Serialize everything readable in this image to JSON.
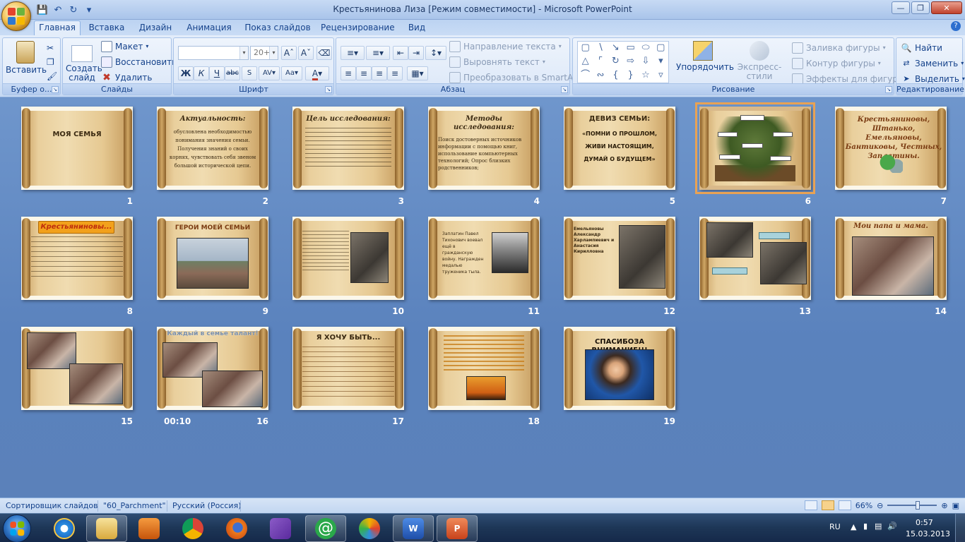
{
  "window": {
    "title": "Крестьянинова Лиза [Режим совместимости] - Microsoft PowerPoint"
  },
  "tabs": [
    "Главная",
    "Вставка",
    "Дизайн",
    "Анимация",
    "Показ слайдов",
    "Рецензирование",
    "Вид"
  ],
  "ribbon": {
    "clipboard": {
      "title": "Буфер о...",
      "paste": "Вставить"
    },
    "slides": {
      "title": "Слайды",
      "create": "Создать слайд",
      "layout": "Макет",
      "reset": "Восстановить",
      "delete": "Удалить"
    },
    "font": {
      "title": "Шрифт",
      "size": "20+"
    },
    "paragraph": {
      "title": "Абзац",
      "text_direction": "Направление текста",
      "align_text": "Выровнять текст",
      "smartart": "Преобразовать в SmartArt"
    },
    "drawing": {
      "title": "Рисование",
      "arrange": "Упорядочить",
      "quick_styles": "Экспресс-стили",
      "fill": "Заливка фигуры",
      "outline": "Контур фигуры",
      "effects": "Эффекты для фигур"
    },
    "editing": {
      "title": "Редактирование",
      "find": "Найти",
      "replace": "Заменить",
      "select": "Выделить"
    }
  },
  "slides": [
    {
      "num": "1",
      "title": "МОЯ СЕМЬЯ"
    },
    {
      "num": "2",
      "title": "Актуальность:",
      "body": "обусловлена необходимостью понимания значения семьи. Получения знаний о своих корнях, чувствовать себя звеном большой исторической цепи."
    },
    {
      "num": "3",
      "title": "Цель исследования:"
    },
    {
      "num": "4",
      "title": "Методы исследования:",
      "body": "Поиск достоверных источников информации с помощью книг, использование компьютерных технологий; Опрос близких родственников;"
    },
    {
      "num": "5",
      "title": "ДЕВИЗ СЕМЬИ:",
      "body": "«ПОМНИ О ПРОШЛОМ, ЖИВИ НАСТОЯЩИМ, ДУМАЙ О БУДУЩЕМ»"
    },
    {
      "num": "6"
    },
    {
      "num": "7",
      "title": "Крестьяниновы, Штанько, Емельяновы, Бантиковы, Честных, Заплатины."
    },
    {
      "num": "8",
      "title": "Крестьяниновы..."
    },
    {
      "num": "9",
      "title": "ГЕРОИ МОЕЙ СЕМЬИ"
    },
    {
      "num": "10"
    },
    {
      "num": "11",
      "body": "Заплатин Павел Тихонович воевал ещё в гражданскую войну. Награжден медалью труженика тыла."
    },
    {
      "num": "12",
      "body": "Емельяновы Александр Харлампиевич и Анастасия Кирилловна"
    },
    {
      "num": "13"
    },
    {
      "num": "14",
      "title": "Мои папа и мама."
    },
    {
      "num": "15"
    },
    {
      "num": "16",
      "title": "Каждый в семье талант!",
      "timing": "00:10"
    },
    {
      "num": "17",
      "title": "Я ХОЧУ БЫТЬ..."
    },
    {
      "num": "18"
    },
    {
      "num": "19",
      "title": "СПАСИБОЗА ВНИМАНИЕ!!!"
    }
  ],
  "status": {
    "view": "Сортировщик слайдов",
    "theme": "\"60_Parchment\"",
    "language": "Русский (Россия)",
    "zoom": "66%"
  },
  "taskbar": {
    "lang": "RU",
    "time": "0:57",
    "date": "15.03.2013"
  }
}
